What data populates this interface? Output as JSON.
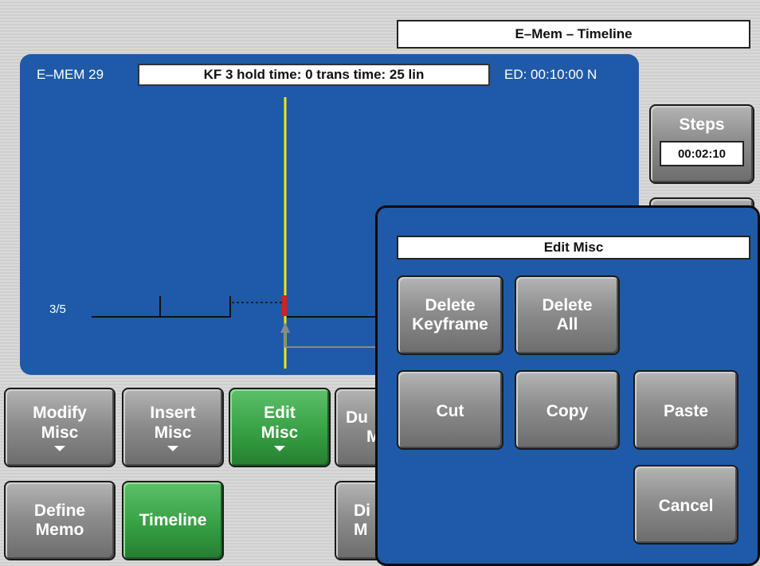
{
  "window": {
    "title": "E–Mem – Timeline"
  },
  "timeline": {
    "emem_label": "E–MEM 29",
    "keyframe_info": "KF 3 hold time: 0 trans time: 25 lin",
    "ed_label": "ED: 00:10:00 N",
    "track_label": "3/5"
  },
  "steps": {
    "label": "Steps",
    "value": "00:02:10"
  },
  "buttons": {
    "modify_misc": [
      "Modify",
      "Misc"
    ],
    "insert_misc": [
      "Insert",
      "Misc"
    ],
    "edit_misc": [
      "Edit",
      "Misc"
    ],
    "dur_partial": [
      "Du",
      "M"
    ],
    "define_memo": [
      "Define",
      "Memo"
    ],
    "timeline": "Timeline",
    "di_partial": [
      "Di",
      "M"
    ]
  },
  "dialog": {
    "title": "Edit Misc",
    "delete_keyframe": [
      "Delete",
      "Keyframe"
    ],
    "delete_all": [
      "Delete",
      "All"
    ],
    "cut": "Cut",
    "copy": "Copy",
    "paste": "Paste",
    "cancel": "Cancel"
  },
  "colors": {
    "panel": "#1f5aa8",
    "playhead": "#f0e60a",
    "keyframe_marker": "#d42020",
    "active_button": "#37a044"
  }
}
